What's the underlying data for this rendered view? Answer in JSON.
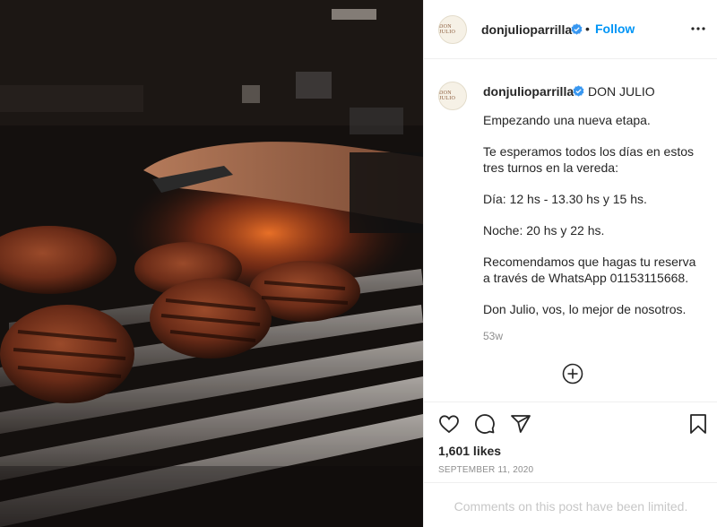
{
  "post": {
    "username": "donjulioparrilla",
    "follow_label": "Follow",
    "separator": "•",
    "avatar_logo_text": "DON JULIO",
    "caption": {
      "username": "donjulioparrilla",
      "name": "DON JULIO",
      "paragraphs": [
        "Empezando una nueva etapa.",
        "Te esperamos todos los días en estos tres turnos en la vereda:",
        "Día: 12 hs - 13.30 hs y 15 hs.",
        "Noche: 20 hs y 22 hs.",
        "Recomendamos que hagas tu reserva a través de WhatsApp 01153115668.",
        "Don Julio, vos, lo mejor de nosotros."
      ],
      "time_ago": "53w"
    },
    "likes": "1,601 likes",
    "date": "SEPTEMBER 11, 2020",
    "comments_limited": "Comments on this post have been limited."
  },
  "icons": {
    "verified": "verified-badge-icon",
    "more": "more-options-icon",
    "add_comment": "plus-circle-icon",
    "like": "heart-icon",
    "comment": "comment-bubble-icon",
    "share": "paper-plane-icon",
    "save": "bookmark-icon"
  },
  "colors": {
    "link_blue": "#0095f6",
    "verified_blue": "#3897f0",
    "muted": "#8e8e8e",
    "border": "#efefef"
  }
}
